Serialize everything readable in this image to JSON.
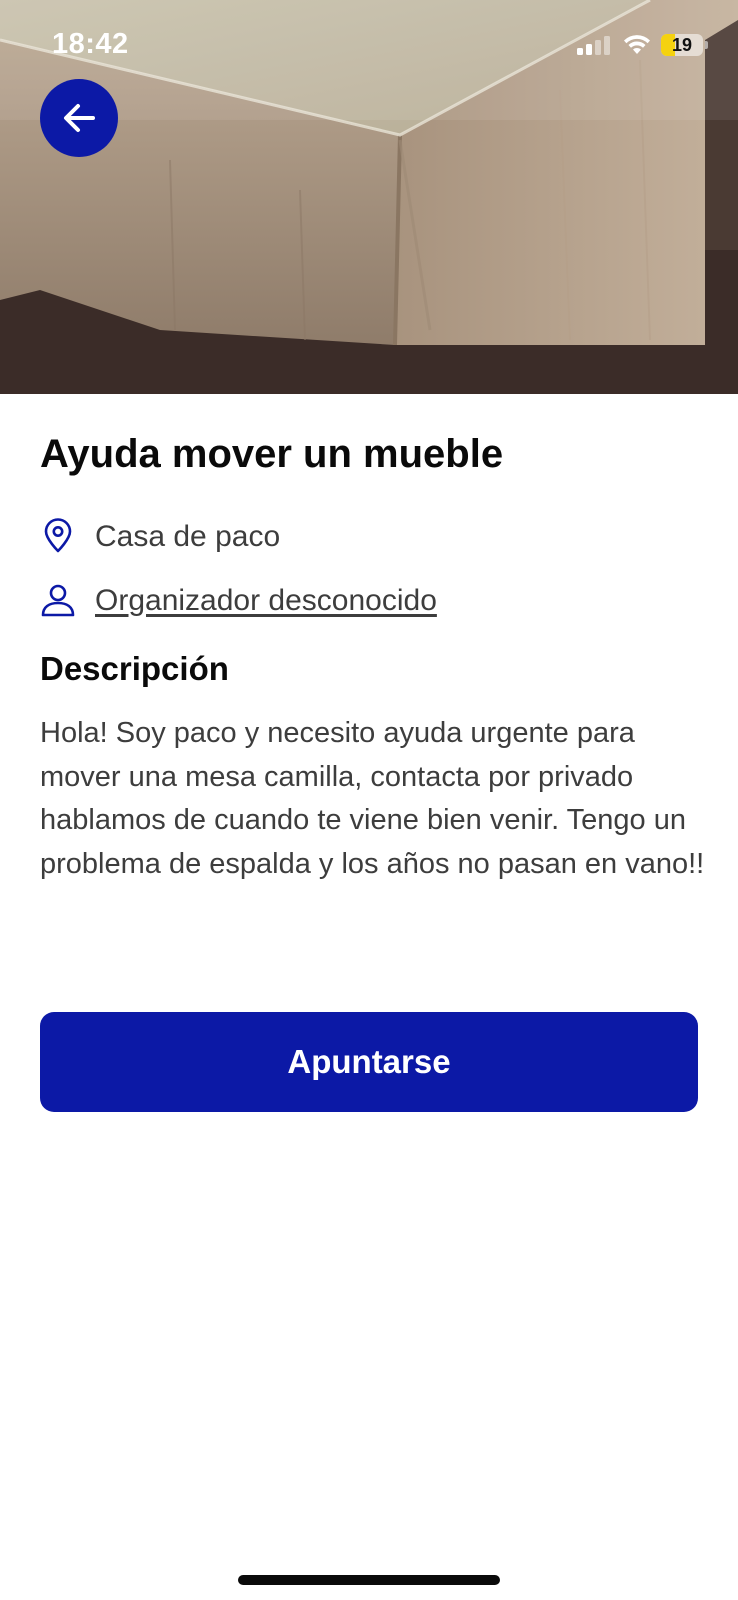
{
  "status_bar": {
    "time": "18:42",
    "battery_level": "19",
    "battery_color": "#f5d20f"
  },
  "hero": {
    "image_icon": "furniture-photo"
  },
  "header": {
    "back_icon": "arrow-left-icon"
  },
  "event": {
    "title": "Ayuda mover un mueble",
    "location": "Casa de paco",
    "organizer": "Organizador desconocido"
  },
  "description": {
    "heading": "Descripción",
    "text": "Hola! Soy paco y necesito ayuda urgente para mover una mesa camilla, contacta por privado hablamos de cuando te viene bien venir. Tengo un problema de espalda y los años no pasan en vano!!"
  },
  "actions": {
    "join_label": "Apuntarse"
  },
  "colors": {
    "accent": "#0c19a6",
    "text_primary": "#0a0a0a",
    "text_secondary": "#3d3d3d"
  }
}
